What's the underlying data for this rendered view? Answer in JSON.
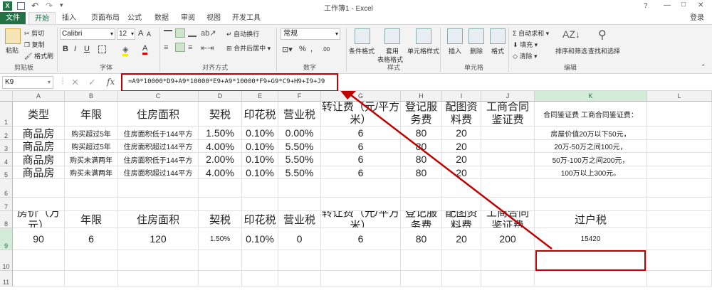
{
  "title": {
    "app_icon": "excel-icon",
    "text": "工作簿1 - Excel",
    "help": "?",
    "minimize": "—",
    "restore": "□",
    "close": "✕",
    "login": "登录"
  },
  "tabs": [
    "文件",
    "开始",
    "插入",
    "页面布局",
    "公式",
    "数据",
    "审阅",
    "视图",
    "开发工具"
  ],
  "ribbon": {
    "clipboard": {
      "paste": "粘贴",
      "cut": "剪切",
      "copy": "复制",
      "format_painter": "格式刷",
      "group": "剪贴板"
    },
    "font": {
      "name": "Calibri",
      "size": "12",
      "grow": "A",
      "shrink": "A",
      "bold": "B",
      "italic": "I",
      "underline": "U",
      "font_color": "A",
      "group": "字体"
    },
    "align": {
      "wrap": "自动换行",
      "merge": "合并后居中",
      "group": "对齐方式"
    },
    "number": {
      "format": "常规",
      "percent": "%",
      "comma": ",",
      "inc": ".00",
      "group": "数字"
    },
    "styles": {
      "cond": "条件格式",
      "table1": "套用",
      "table2": "表格格式",
      "cell_styles": "单元格样式",
      "group": "样式"
    },
    "cells": {
      "insert": "插入",
      "delete": "删除",
      "format": "格式",
      "group": "单元格"
    },
    "editing": {
      "autosum": "自动求和",
      "fill": "填充",
      "clear": "清除",
      "sort": "排序和筛选",
      "find": "查找和选择",
      "group": "编辑"
    }
  },
  "formula_bar": {
    "name_box": "K9",
    "cancel": "✕",
    "enter": "✓",
    "fx": "fx",
    "formula": "=A9*10000*D9+A9*10000*E9+A9*10000*F9+G9*C9+H9+I9+J9"
  },
  "columns": [
    "A",
    "B",
    "C",
    "D",
    "E",
    "F",
    "G",
    "H",
    "I",
    "J",
    "K",
    "L"
  ],
  "rows": [
    "1",
    "2",
    "3",
    "4",
    "5",
    "6",
    "7",
    "8",
    "9",
    "10",
    "11"
  ],
  "table1": {
    "headers": [
      "类型",
      "年限",
      "住房面积",
      "契税",
      "印花税",
      "营业税",
      "转让费（元/平方米）",
      "登记服务费",
      "配图资料费",
      "工商合同鉴证费",
      "合同鉴证费 工商合同鉴证费："
    ],
    "rows": [
      [
        "商品房",
        "购买超过5年",
        "住房面积低于144平方",
        "1.50%",
        "0.10%",
        "0.00%",
        "6",
        "80",
        "20",
        "",
        "房屋价值20万以下50元，"
      ],
      [
        "商品房",
        "购买超过5年",
        "住房面积超过144平方",
        "4.00%",
        "0.10%",
        "5.50%",
        "6",
        "80",
        "20",
        "",
        "20万-50万之间100元，"
      ],
      [
        "商品房",
        "购买未满两年",
        "住房面积低于144平方",
        "2.00%",
        "0.10%",
        "5.50%",
        "6",
        "80",
        "20",
        "",
        "50万-100万之间200元，"
      ],
      [
        "商品房",
        "购买未满两年",
        "住房面积超过144平方",
        "4.00%",
        "0.10%",
        "5.50%",
        "6",
        "80",
        "20",
        "",
        "100万以上300元。"
      ]
    ]
  },
  "table2": {
    "headers": [
      "房价（万元）",
      "年限",
      "住房面积",
      "契税",
      "印花税",
      "营业税",
      "转让费（元/平方米）",
      "登记服务费",
      "配图资料费",
      "工商合同鉴证费",
      "过户税"
    ],
    "values": [
      "90",
      "6",
      "120",
      "1.50%",
      "0.10%",
      "0",
      "6",
      "80",
      "20",
      "200",
      "15420"
    ]
  },
  "colors": {
    "excel_green": "#217346",
    "annotation_red": "#c00000"
  }
}
